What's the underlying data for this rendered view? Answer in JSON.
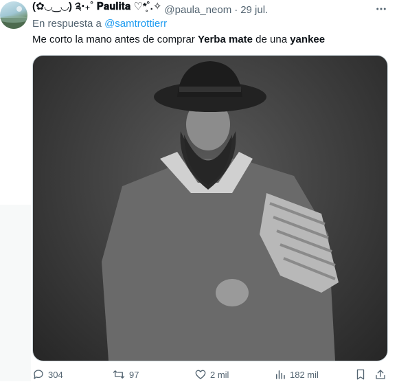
{
  "tweet": {
    "author": {
      "display_name": "(✿◡‿◡) ༉‧₊˚ 𝐏𝐚𝐮𝐥𝐢𝐭𝐚 ♡*̥˚.✧",
      "handle": "@paula_neom",
      "separator": "·",
      "date": "29 jul."
    },
    "reply_prefix": "En respuesta a",
    "reply_mention": "@samtrottierr",
    "text": {
      "part1": "Me corto la mano antes de comprar ",
      "bold1": "Yerba mate",
      "part2": " de una ",
      "bold2": "yankee"
    },
    "icons": {
      "more": "more-icon",
      "reply": "reply-icon",
      "retweet": "retweet-icon",
      "like": "heart-icon",
      "views": "analytics-icon",
      "bookmark": "bookmark-icon",
      "share": "share-icon"
    },
    "stats": {
      "replies": "304",
      "retweets": "97",
      "likes": "2 mil",
      "views": "182 mil"
    }
  },
  "colors": {
    "accent": "#1d9bf0",
    "secondary_text": "#536471",
    "primary_text": "#0f1419"
  }
}
